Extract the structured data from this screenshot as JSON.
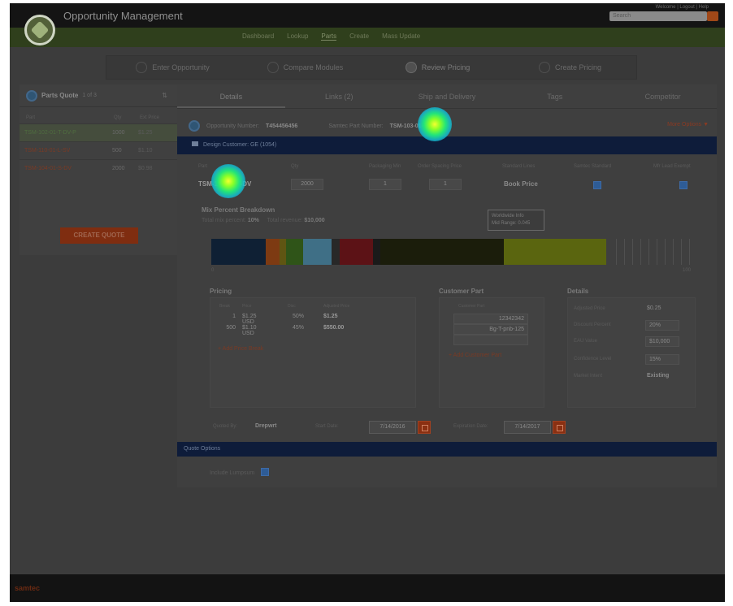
{
  "header": {
    "app_title": "Opportunity Management",
    "top_links": "Welcome | Logout | Help",
    "search_placeholder": "Search",
    "nav": [
      "Dashboard",
      "Lookup",
      "Parts",
      "Create",
      "Mass Update"
    ],
    "nav_active_index": 2
  },
  "workflow": {
    "steps": [
      "Enter Opportunity",
      "Compare Modules",
      "Review Pricing",
      "Create Pricing"
    ],
    "active_index": 2
  },
  "parts_panel": {
    "title": "Parts Quote",
    "count": "1 of 3",
    "columns": [
      "Part",
      "Qty",
      "Ext Price"
    ],
    "rows": [
      {
        "part": "TSM-102-01-T-DV-P",
        "qty": "1000",
        "ext": "$1.25"
      },
      {
        "part": "TSM-110-01-L-SV",
        "qty": "500",
        "ext": "$1.10"
      },
      {
        "part": "TSM-104-01-S-DV",
        "qty": "2000",
        "ext": "$0.98"
      }
    ],
    "create_quote": "CREATE QUOTE"
  },
  "tabs": [
    "Details",
    "Links (2)",
    "Ship and Delivery",
    "Tags",
    "Competitor"
  ],
  "opportunity": {
    "label": "Opportunity Number:",
    "number": "T454456456",
    "samtec_label": "Samtec Part Number:",
    "samtec_pn": "TSM-103-01-T-DV-P",
    "more_options": "More Options ▼"
  },
  "design_customer": "Design Customer: GE (1054)",
  "fields": {
    "labels": [
      "Part",
      "Qty",
      "Packaging Min",
      "Order Spacing Price",
      "Standard Lines",
      "Samtec Standard",
      "Mfr Lead Exempt"
    ],
    "part_number": "TSM-103-01-T-DV",
    "qty": "2000",
    "pack_min": "1",
    "order_spacing": "1",
    "standard_lines": "Book Price"
  },
  "mix": {
    "title": "Mix Percent Breakdown",
    "pct_label": "Total mix percent:",
    "pct_value": "10%",
    "rev_label": "Total revenue:",
    "rev_value": "$10,000",
    "tooltip_line1": "Worldwide Info",
    "tooltip_line2": "Mid Range: 0.045",
    "axis_min": "0",
    "axis_max": "100",
    "segments": [
      {
        "pct": 13.8,
        "color": "#0f2034"
      },
      {
        "pct": 3.5,
        "color": "#7d3a12"
      },
      {
        "pct": 1.6,
        "color": "#5f5512"
      },
      {
        "pct": 4.4,
        "color": "#2f5418"
      },
      {
        "pct": 7.2,
        "color": "#3f6f86"
      },
      {
        "pct": 2.1,
        "color": "#282828"
      },
      {
        "pct": 8.3,
        "color": "#5c1216"
      },
      {
        "pct": 2.0,
        "color": "#1a1a1a"
      },
      {
        "pct": 31.1,
        "color": "#1b1d0b"
      },
      {
        "pct": 26.0,
        "color": "#5a650f"
      }
    ]
  },
  "pricing": {
    "title": "Pricing",
    "col_heads": [
      "Break",
      "Price",
      "Disc",
      "Adjusted Price"
    ],
    "rows": [
      {
        "qty": "1",
        "price": "$1.25 USD",
        "disc": "50%",
        "adj": "$1.25"
      },
      {
        "qty": "500",
        "price": "$1.10 USD",
        "disc": "45%",
        "adj": "$550.00"
      }
    ],
    "add_link": "+ Add Price Break"
  },
  "customer_part": {
    "title": "Customer Part",
    "col_head": "Customer Part",
    "values": [
      "12342342",
      "Bg-T-pnb-125",
      ""
    ],
    "add_link": "+ Add Customer Part"
  },
  "details": {
    "title": "Details",
    "rows": [
      {
        "label": "Adjusted Price",
        "value": "$0.25"
      },
      {
        "label": "Discount Percent",
        "value": "20%"
      },
      {
        "label": "EAU Value",
        "value": "$10,000"
      },
      {
        "label": "Confidence Level",
        "value": "15%"
      },
      {
        "label": "Market Intent",
        "value": "Existing"
      }
    ]
  },
  "bottom": {
    "quote_by_label": "Quoted By:",
    "quote_by": "Drepwrt",
    "start_label": "Start Date:",
    "start_date": "7/14/2016",
    "exp_label": "Expiration Date:",
    "exp_date": "7/14/2017"
  },
  "quote_options": "Quote Options",
  "vat_label": "Include Lumpsum",
  "footer_logo": "samtec"
}
